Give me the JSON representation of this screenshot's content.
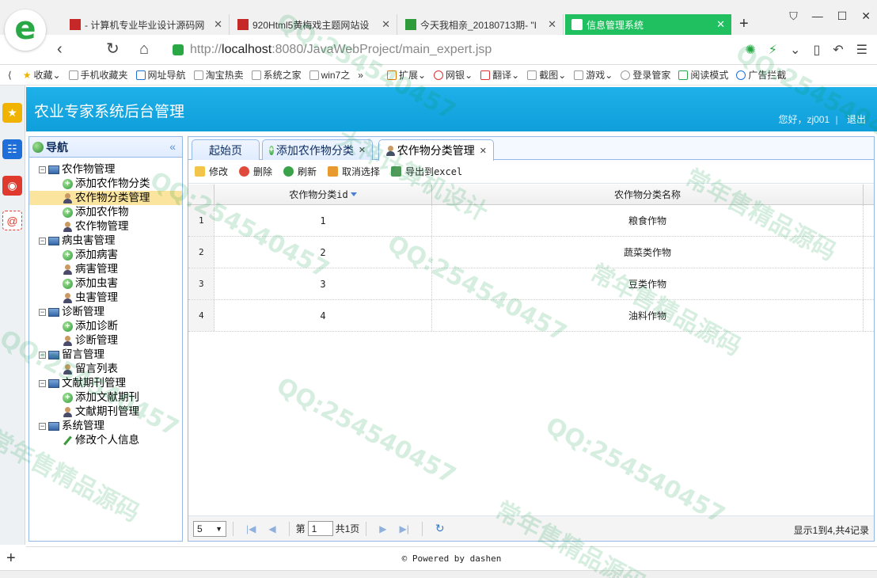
{
  "browser": {
    "tabs": [
      {
        "title": "- 计算机专业毕业设计源码网",
        "favicon_color": "#c62828"
      },
      {
        "title": "920Html5黄梅戏主题网站设",
        "favicon_color": "#c62828"
      },
      {
        "title": "今天我相亲_20180713期- \"I",
        "favicon_color": "#2e9b3a"
      },
      {
        "title": "信息管理系统",
        "favicon_color": "#ffffff"
      }
    ],
    "url_prefix": "http://",
    "url_host": "localhost",
    "url_rest": ":8080/JavaWebProject/main_expert.jsp",
    "bookmarks": [
      "收藏",
      "手机收藏夹",
      "网址导航",
      "淘宝热卖",
      "系统之家",
      "win7之"
    ],
    "bookmarks_right": [
      "扩展",
      "网银",
      "翻译",
      "截图",
      "游戏",
      "登录管家",
      "阅读模式",
      "广告拦截"
    ]
  },
  "app": {
    "title": "农业专家系统后台管理",
    "greeting": "您好，zj001",
    "logout": "退出",
    "nav_title": "导航",
    "collapse_glyph": "«",
    "tree": [
      {
        "label": "农作物管理",
        "children": [
          {
            "label": "添加农作物分类",
            "icon": "add"
          },
          {
            "label": "农作物分类管理",
            "icon": "person",
            "selected": true
          },
          {
            "label": "添加农作物",
            "icon": "add"
          },
          {
            "label": "农作物管理",
            "icon": "person"
          }
        ]
      },
      {
        "label": "病虫害管理",
        "children": [
          {
            "label": "添加病害",
            "icon": "add"
          },
          {
            "label": "病害管理",
            "icon": "person"
          },
          {
            "label": "添加虫害",
            "icon": "add"
          },
          {
            "label": "虫害管理",
            "icon": "person"
          }
        ]
      },
      {
        "label": "诊断管理",
        "children": [
          {
            "label": "添加诊断",
            "icon": "add"
          },
          {
            "label": "诊断管理",
            "icon": "person"
          }
        ]
      },
      {
        "label": "留言管理",
        "children": [
          {
            "label": "留言列表",
            "icon": "person"
          }
        ]
      },
      {
        "label": "文献期刊管理",
        "children": [
          {
            "label": "添加文献期刊",
            "icon": "add"
          },
          {
            "label": "文献期刊管理",
            "icon": "person"
          }
        ]
      },
      {
        "label": "系统管理",
        "children": [
          {
            "label": "修改个人信息",
            "icon": "pencil"
          }
        ]
      }
    ],
    "content_tabs": [
      "起始页",
      "添加农作物分类",
      "农作物分类管理"
    ],
    "toolbar": {
      "edit": "修改",
      "delete": "删除",
      "refresh": "刷新",
      "clear_selection": "取消选择",
      "export": "导出到excel"
    },
    "grid": {
      "columns": [
        "农作物分类id",
        "农作物分类名称"
      ],
      "rows": [
        {
          "n": "1",
          "id": "1",
          "name": "粮食作物"
        },
        {
          "n": "2",
          "id": "2",
          "name": "蔬菜类作物"
        },
        {
          "n": "3",
          "id": "3",
          "name": "豆类作物"
        },
        {
          "n": "4",
          "id": "4",
          "name": "油料作物"
        }
      ]
    },
    "pager": {
      "page_size": "5",
      "page_label_before": "第",
      "page_value": "1",
      "page_label_after": "共1页",
      "info": "显示1到4,共4记录"
    },
    "footer": "Powered by dashen"
  },
  "watermark": [
    "常年售精品源码",
    "QQ:254540457",
    "大神计算机设计"
  ]
}
